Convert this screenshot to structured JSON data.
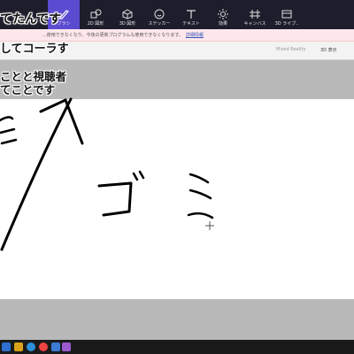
{
  "captions": {
    "line1": "てたんです",
    "line2": "してコーラす",
    "line3": "ことと視聴者",
    "line4": "てことです"
  },
  "toolbar": {
    "tools": [
      {
        "label": "ブラシ",
        "icon": "brush-icon",
        "active": true
      },
      {
        "label": "2D 図形",
        "icon": "2d-shapes-icon"
      },
      {
        "label": "3D 図形",
        "icon": "3d-shapes-icon"
      },
      {
        "label": "ステッカー",
        "icon": "stickers-icon"
      },
      {
        "label": "テキスト",
        "icon": "text-icon"
      },
      {
        "label": "効果",
        "icon": "effects-icon"
      },
      {
        "label": "キャンバス",
        "icon": "canvas-icon"
      },
      {
        "label": "3D ライブ..",
        "icon": "3d-library-icon"
      }
    ],
    "accent": "#5b4bd1",
    "background": "#1d1d2b"
  },
  "notice": {
    "text": "...使用できなくなり、今後の更新プログラムも使用できなくなります。",
    "link": "詳細情報"
  },
  "subbar": {
    "mixed_reality": "Mixed Reality",
    "view_3d": "3D 表示"
  },
  "canvas": {
    "drawn_text": "ゴミ"
  },
  "colors": {
    "canvas_bg": "#ffffff",
    "workspace_bg": "#b9b9b9",
    "notice_bg": "#fde7ea",
    "taskbar_bg": "#1a1a1a"
  }
}
